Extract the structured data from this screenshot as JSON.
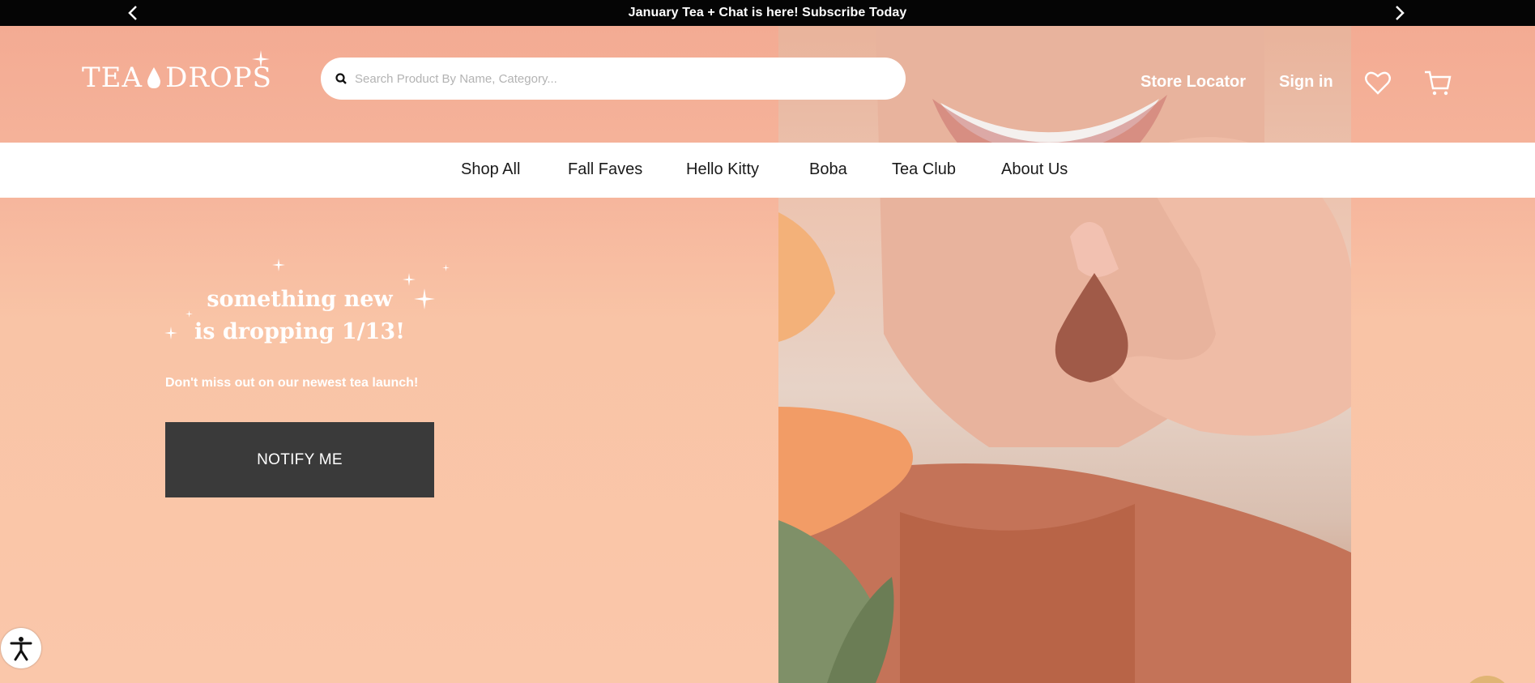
{
  "announcement": {
    "text": "January Tea + Chat is here! Subscribe Today"
  },
  "header": {
    "logo_text_left": "TEA",
    "logo_text_right": "DROPS",
    "search_placeholder": "Search Product By Name, Category...",
    "store_locator": "Store Locator",
    "sign_in": "Sign in"
  },
  "nav": {
    "items": [
      "Shop All",
      "Fall Faves",
      "Hello Kitty",
      "Boba",
      "Tea Club",
      "About Us"
    ]
  },
  "promo": {
    "title_line1": "something new",
    "title_line2": "is dropping 1/13!",
    "subtitle": "Don't miss out on our newest tea launch!",
    "cta": "NOTIFY ME"
  },
  "colors": {
    "background": "#f9c4a6",
    "announcement_bar": "#050505",
    "cta_button": "#3a3a3a"
  },
  "icons": {
    "announcement_prev": "chevron-left-icon",
    "announcement_next": "chevron-right-icon",
    "search": "search-icon",
    "wishlist": "heart-icon",
    "cart": "cart-icon",
    "accessibility": "accessibility-icon"
  }
}
